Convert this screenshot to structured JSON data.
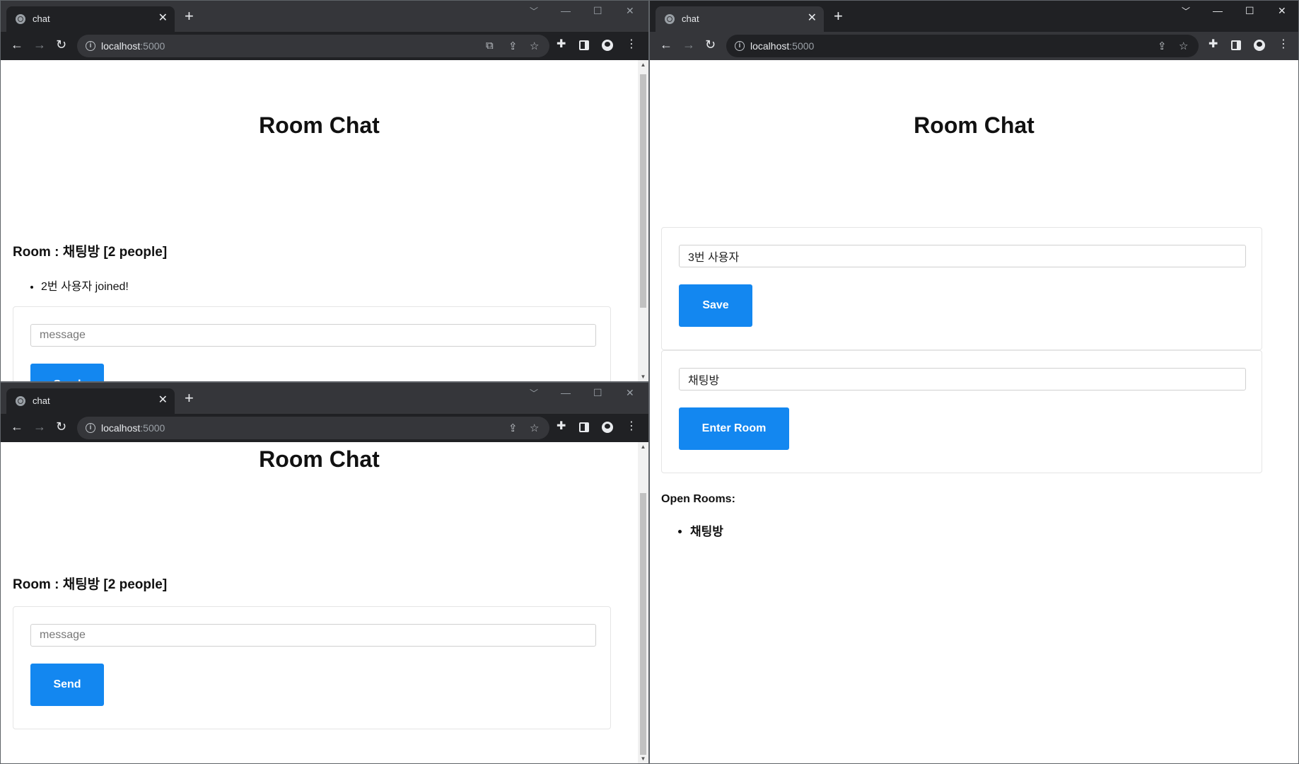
{
  "browser": {
    "tab_title": "chat",
    "tab_close": "✕",
    "new_tab": "+",
    "url_host": "localhost",
    "url_port": ":5000"
  },
  "app": {
    "title": "Room Chat",
    "room_heading": "Room : 채팅방 [2 people]",
    "message_placeholder": "message",
    "send_label": "Send"
  },
  "window_top_left": {
    "messages": [
      "2번 사용자 joined!"
    ]
  },
  "window_right": {
    "username_value": "3번 사용자",
    "save_label": "Save",
    "room_value": "채팅방",
    "enter_room_label": "Enter Room",
    "open_rooms_label": "Open Rooms:",
    "open_rooms": [
      "채팅방"
    ]
  }
}
